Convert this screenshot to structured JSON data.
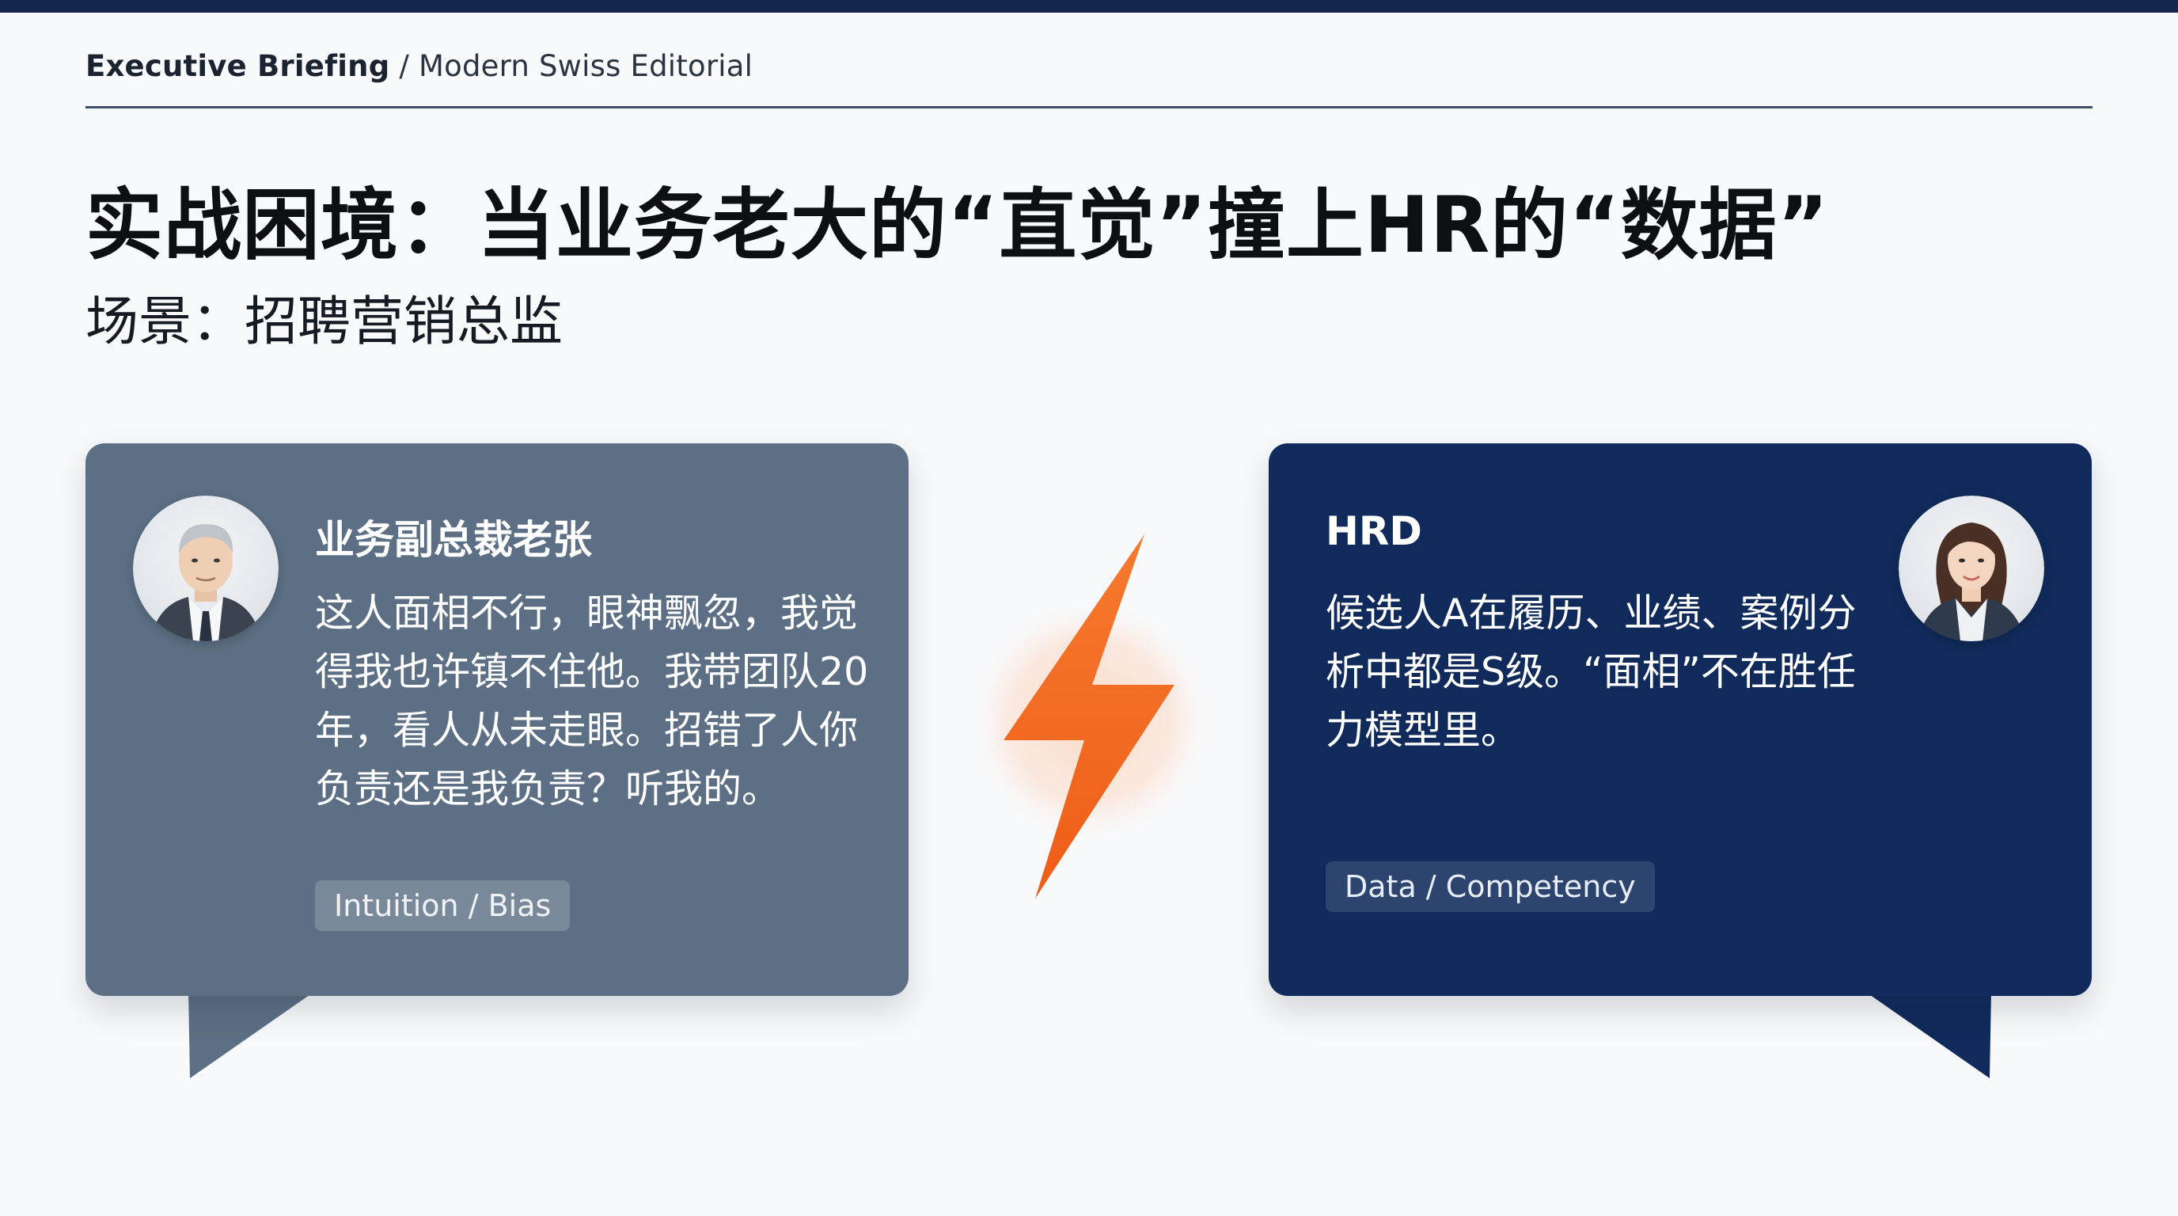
{
  "header": {
    "brand": "Executive Briefing",
    "separator": " / ",
    "section": "Modern Swiss Editorial"
  },
  "title": "实战困境：当业务老大的“直觉”撞上HR的“数据”",
  "subtitle": "场景：招聘营销总监",
  "left_card": {
    "speaker": "业务副总裁老张",
    "quote": "这人面相不行，眼神飘忽，我觉得我也许镇不住他。我带团队20年，看人从未走眼。招错了人你负责还是我负责？听我的。",
    "tag": "Intuition / Bias",
    "avatar_icon": "male-executive-avatar"
  },
  "right_card": {
    "speaker": "HRD",
    "quote": "候选人A在履历、业绩、案例分析中都是S级。“面相”不在胜任力模型里。",
    "tag": "Data / Competency",
    "avatar_icon": "female-professional-avatar"
  },
  "center_icon": "lightning-bolt-icon",
  "colors": {
    "top_bar": "#13274e",
    "left_card": "#5c6f84",
    "right_card": "#102b5b",
    "accent": "#f26a21"
  }
}
